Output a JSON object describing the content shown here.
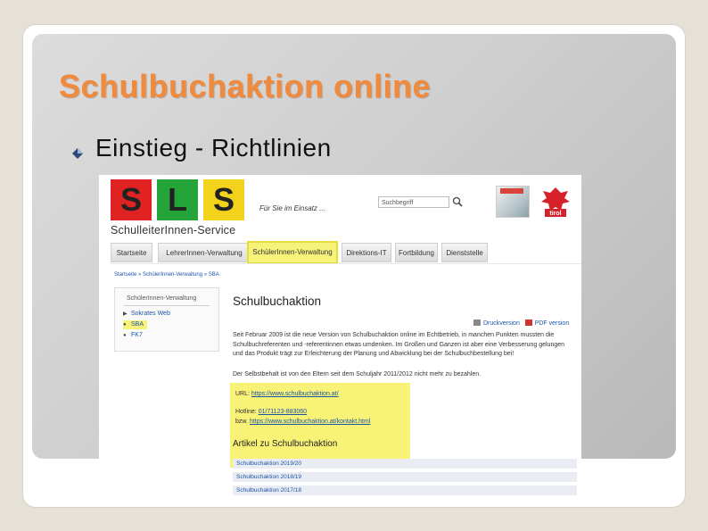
{
  "slide": {
    "title": "Schulbuchaktion online",
    "subtitle": "Einstieg - Richtlinien"
  },
  "site": {
    "logo": {
      "letters": [
        "S",
        "L",
        "S"
      ],
      "subtitle": "SchulleiterInnen-Service"
    },
    "tagline": "Für Sie im Einsatz ...",
    "search": {
      "placeholder": "Suchbegriff"
    },
    "tirol_logo_text": "tirol",
    "nav": [
      {
        "label": "Startseite"
      },
      {
        "label": "LehrerInnen-Verwaltung"
      },
      {
        "label": "SchülerInnen-Verwaltung",
        "active": true
      },
      {
        "label": "Direktions-IT"
      },
      {
        "label": "Fortbildung"
      },
      {
        "label": "Dienststelle"
      }
    ],
    "breadcrumb": [
      "Startseite",
      "SchülerInnen-Verwaltung",
      "SBA"
    ],
    "sidebar": {
      "title": "SchülerInnen-Verwaltung",
      "items": [
        {
          "label": "Sokrates Web"
        },
        {
          "label": "SBA",
          "selected": true
        },
        {
          "label": "FK7"
        }
      ]
    },
    "content": {
      "title": "Schulbuchaktion",
      "print_label": "Druckversion",
      "pdf_label": "PDF version",
      "paragraph": "Seit Februar 2009 ist die neue Version von Schulbuchaktion online im Echtbetrieb, in manchen Punkten mussten die Schulbuchreferenten und -referentinnen etwas umdenken. Im Großen und Ganzen ist aber eine Verbesserung gelungen und das Produkt trägt zur Erleichterung der Planung und Abwicklung bei der Schulbuchbestellung bei!",
      "paragraph2": "Der Selbstbehalt ist von den Eltern seit dem Schuljahr 2011/2012 nicht mehr zu bezahlen.",
      "url_label": "URL:",
      "url": "https://www.schulbuchaktion.at/",
      "hotline_label": "Hotline:",
      "hotline": "01/71123-883060",
      "bzw_label": "bzw.",
      "bzw_url": "https://www.schulbuchaktion.at/kontakt.html"
    },
    "articles": {
      "title": "Artikel zu Schulbuchaktion",
      "items": [
        "Schulbuchaktion 2019/20",
        "Schulbuchaktion 2018/19",
        "Schulbuchaktion 2017/18"
      ]
    }
  },
  "colors": {
    "title_orange": "#f08a3c",
    "highlight_yellow": "#f7f05f",
    "sls_red": "#e02222",
    "sls_green": "#25a43a",
    "sls_yellow": "#f2d21a",
    "link_blue": "#1a55a8"
  },
  "icons": [
    "bullet-diamond-icon",
    "search-icon",
    "print-icon",
    "pdf-icon",
    "tirol-eagle-icon"
  ]
}
